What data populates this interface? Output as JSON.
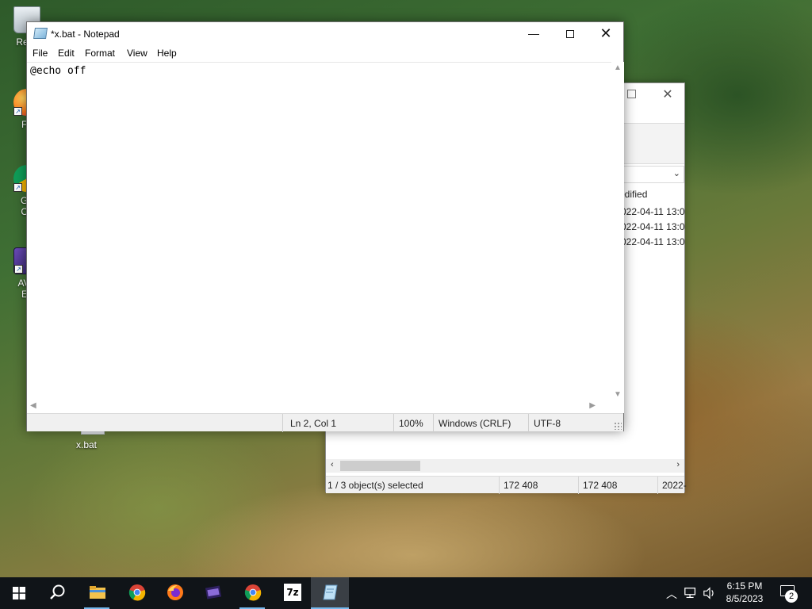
{
  "desktop": {
    "icons": [
      {
        "label": "Recy",
        "icon": "recycle-bin-icon"
      },
      {
        "label": "Fir",
        "icon": "firefox-icon"
      },
      {
        "label_line1": "Go",
        "label_line2": "Ch",
        "icon": "google-chrome-icon"
      },
      {
        "label_line1": "AVS",
        "label_line2": "Ec",
        "icon": "avs-video-editor-icon"
      }
    ],
    "file_icon_label": "x.bat"
  },
  "notepad": {
    "title": "*x.bat - Notepad",
    "menu": [
      "File",
      "Edit",
      "Format",
      "View",
      "Help"
    ],
    "content": "@echo off",
    "status": {
      "position": "Ln 2, Col 1",
      "zoom": "100%",
      "line_endings": "Windows (CRLF)",
      "encoding": "UTF-8"
    }
  },
  "explorer": {
    "column_header": "odified",
    "rows": [
      "022-04-11 13:0",
      "022-04-11 13:0",
      "022-04-11 13:0"
    ],
    "status": {
      "selection": "1 / 3 object(s) selected",
      "size1": "172 408",
      "size2": "172 408",
      "date": "2022-"
    }
  },
  "taskbar": {
    "apps": [
      "start-icon",
      "search-icon",
      "file-explorer-icon",
      "google-chrome-icon",
      "firefox-icon",
      "avs-video-editor-icon",
      "google-chrome-icon",
      "7zip-icon",
      "notepad-icon"
    ],
    "seven_zip_label": "7z",
    "time": "6:15 PM",
    "date": "8/5/2023",
    "notification_count": "2"
  },
  "colors": {
    "taskbar": "#101418",
    "accent": "#76b9ed",
    "window_bg": "#ffffff",
    "status_bg": "#f0f0f0"
  }
}
